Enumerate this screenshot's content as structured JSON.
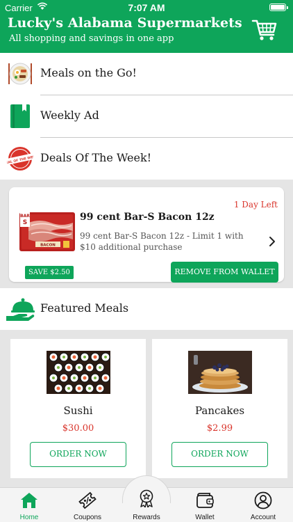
{
  "status": {
    "carrier": "Carrier",
    "time": "7:07 AM"
  },
  "header": {
    "title": "Lucky's Alabama Supermarkets",
    "subtitle": "All shopping and savings in one app",
    "cart_icon": "cart-icon"
  },
  "menu": [
    {
      "label": "Meals on the Go!",
      "icon": "meals-plate-icon"
    },
    {
      "label": "Weekly Ad",
      "icon": "book-icon"
    },
    {
      "label": "Deals Of The Week!",
      "icon": "deal-badge-icon",
      "badge_text": "DEAL OF THE WEEK"
    }
  ],
  "deal": {
    "days_left": "1 Day Left",
    "title": "99 cent Bar-S Bacon 12z",
    "description": "99 cent Bar-S Bacon 12z - Limit 1 with $10 additional purchase",
    "save": "SAVE $2.50",
    "action": "REMOVE FROM WALLET",
    "image_brand": "BAR S",
    "image_product": "BACON"
  },
  "featured": {
    "label": "Featured Meals",
    "icon": "cloche-hand-icon"
  },
  "meals": [
    {
      "name": "Sushi",
      "price": "$30.00",
      "action": "ORDER NOW"
    },
    {
      "name": "Pancakes",
      "price": "$2.99",
      "action": "ORDER NOW"
    }
  ],
  "tabs": [
    {
      "label": "Home",
      "icon": "home-icon",
      "active": true
    },
    {
      "label": "Coupons",
      "icon": "coupon-icon"
    },
    {
      "label": "Rewards",
      "icon": "rewards-ribbon-icon"
    },
    {
      "label": "Wallet",
      "icon": "wallet-icon"
    },
    {
      "label": "Account",
      "icon": "account-icon"
    }
  ],
  "colors": {
    "brand": "#0ea55a",
    "price": "#d9342b",
    "background_gray": "#e5e5e5"
  }
}
